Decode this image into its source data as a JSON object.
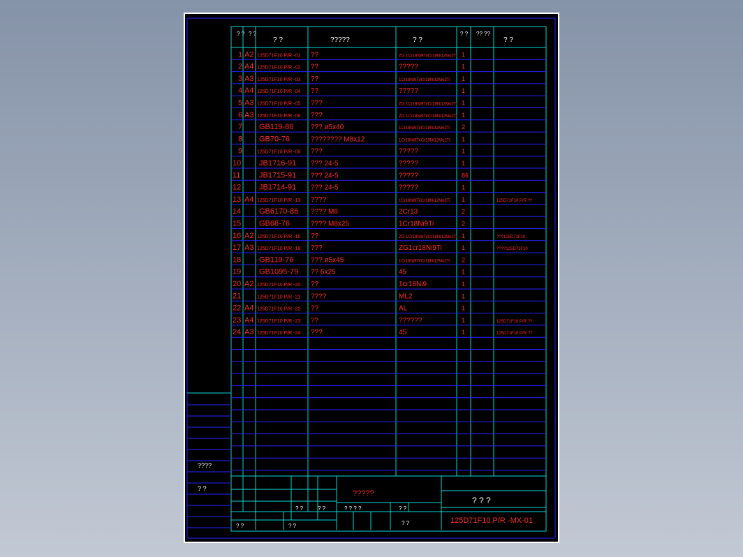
{
  "header": {
    "col_no": "?\n?",
    "col_size": "?\n?",
    "col_code": "?  ?",
    "col_name": "?????",
    "col_material": "?  ?",
    "col_qty": "?\n?",
    "col_unit": "??\n??",
    "col_remark": "?    ?"
  },
  "rows": [
    {
      "no": "1",
      "size": "A2",
      "code": "125D71F10 P/R -01",
      "name": "??",
      "material": "ZG 1Cr18Ni9Ti/Cr18Ni12Mo2Ti",
      "qty": "1",
      "remark": ""
    },
    {
      "no": "2",
      "size": "A4",
      "code": "125D71F10 P/R -02",
      "name": "??",
      "material": "?????",
      "qty": "1",
      "remark": ""
    },
    {
      "no": "3",
      "size": "A3",
      "code": "125D71F10 P/R -03",
      "name": "??",
      "material": "1Cr18Ni9Ti/Cr18Ni12Mo2Ti",
      "qty": "1",
      "remark": ""
    },
    {
      "no": "4",
      "size": "A4",
      "code": "125D71F10 P/R -04",
      "name": "??",
      "material": "?????",
      "qty": "1",
      "remark": ""
    },
    {
      "no": "5",
      "size": "A3",
      "code": "125D71F10 P/R -05",
      "name": "???",
      "material": "ZG 1Cr18Ni9Ti/Cr18Ni12Mo2Ti",
      "qty": "1",
      "remark": ""
    },
    {
      "no": "6",
      "size": "A3",
      "code": "125D71F10 P/R -06",
      "name": "???",
      "material": "ZG 1Cr18Ni9Ti/Cr18Ni12Mo2Ti",
      "qty": "1",
      "remark": ""
    },
    {
      "no": "7",
      "size": "",
      "code": "GB119-86",
      "name": "???   ø5x40",
      "material": "1Cr18Ni9Ti/Cr18Ni12Mo2Ti",
      "qty": "2",
      "remark": ""
    },
    {
      "no": "8",
      "size": "",
      "code": "GB70-76",
      "name": "????????      M8x12",
      "material": "1Cr18Ni9Ti/Cr18Ni12Mo2Ti",
      "qty": "1",
      "remark": ""
    },
    {
      "no": "9",
      "size": "",
      "code": "125D71F10 P/R -09",
      "name": "???",
      "material": "?????",
      "qty": "1",
      "remark": ""
    },
    {
      "no": "10",
      "size": "",
      "code": "JB1716-91",
      "name": "???   24-5",
      "material": "?????",
      "qty": "1",
      "remark": ""
    },
    {
      "no": "11",
      "size": "",
      "code": "JB1715-91",
      "name": "???   24-5",
      "material": "?????",
      "qty": "86",
      "remark": ""
    },
    {
      "no": "12",
      "size": "",
      "code": "JB1714-91",
      "name": "???   24-5",
      "material": "?????",
      "qty": "1",
      "remark": ""
    },
    {
      "no": "13",
      "size": "A4",
      "code": "125D71F10 P/R -13",
      "name": "????",
      "material": "1Cr18Ni9Ti/Cr18Ni12Mo2Ti",
      "qty": "1",
      "remark": "125D71F10 P/R ??"
    },
    {
      "no": "14",
      "size": "",
      "code": "GB6170-86",
      "name": "????   M8",
      "material": "2Cr13",
      "qty": "2",
      "remark": ""
    },
    {
      "no": "15",
      "size": "",
      "code": "GB68-76",
      "name": "????     M8x25",
      "material": "1Cr18Ni9Ti",
      "qty": "2",
      "remark": ""
    },
    {
      "no": "16",
      "size": "A2",
      "code": "125D71F10 P/R -16",
      "name": "??",
      "material": "ZG 1Cr18Ni9Ti/Cr18Ni12Mo2Ti",
      "qty": "1",
      "remark": "???125D71F10"
    },
    {
      "no": "17",
      "size": "A3",
      "code": "125D71F10 P/R -18",
      "name": "???",
      "material": "ZG1cr18Ni9Ti",
      "qty": "1",
      "remark": "????125D71F10"
    },
    {
      "no": "18",
      "size": "",
      "code": "GB119-76",
      "name": "???   ø5x45",
      "material": "1Cr18Ni9Ti/Cr18Ni12Mo2Ti",
      "qty": "2",
      "remark": ""
    },
    {
      "no": "19",
      "size": "",
      "code": "GB1095-79",
      "name": "??     6x25",
      "material": "45",
      "qty": "1",
      "remark": ""
    },
    {
      "no": "20",
      "size": "A2",
      "code": "125D71F10 P/R -20",
      "name": "??",
      "material": "1cr18Ni9",
      "qty": "1",
      "remark": ""
    },
    {
      "no": "21",
      "size": "",
      "code": "125D71F10 P/R -21",
      "name": "????",
      "material": "ML2",
      "qty": "1",
      "remark": ""
    },
    {
      "no": "22",
      "size": "A4",
      "code": "125D71F10 P/R -22",
      "name": "??",
      "material": "AL",
      "qty": "1",
      "remark": ""
    },
    {
      "no": "23",
      "size": "A4",
      "code": "125D71F10 P/R -23",
      "name": "??",
      "material": "??????",
      "qty": "1",
      "remark": "125D71F10 P/R ??"
    },
    {
      "no": "24",
      "size": "A3",
      "code": "125D71F10 P/R -24",
      "name": "???",
      "material": "45",
      "qty": "1",
      "remark": "125D71F10 P/R ??"
    }
  ],
  "left_block": {
    "label_a": "????",
    "label_b": "?   ?"
  },
  "title_block": {
    "center_title": "?????",
    "doc_name": "?  ?  ?",
    "drawing_no": "125D71F10 P/R -MX-01",
    "labels": [
      "? ?",
      "? ?",
      "? ? ? ?",
      "?   ?",
      "? ?",
      "? ?",
      "?   ?"
    ]
  },
  "colors": {
    "sheet": "#000000",
    "grid": "#00d7d7",
    "blue_lines": "#2323ff",
    "text": "#ff2a2a"
  }
}
